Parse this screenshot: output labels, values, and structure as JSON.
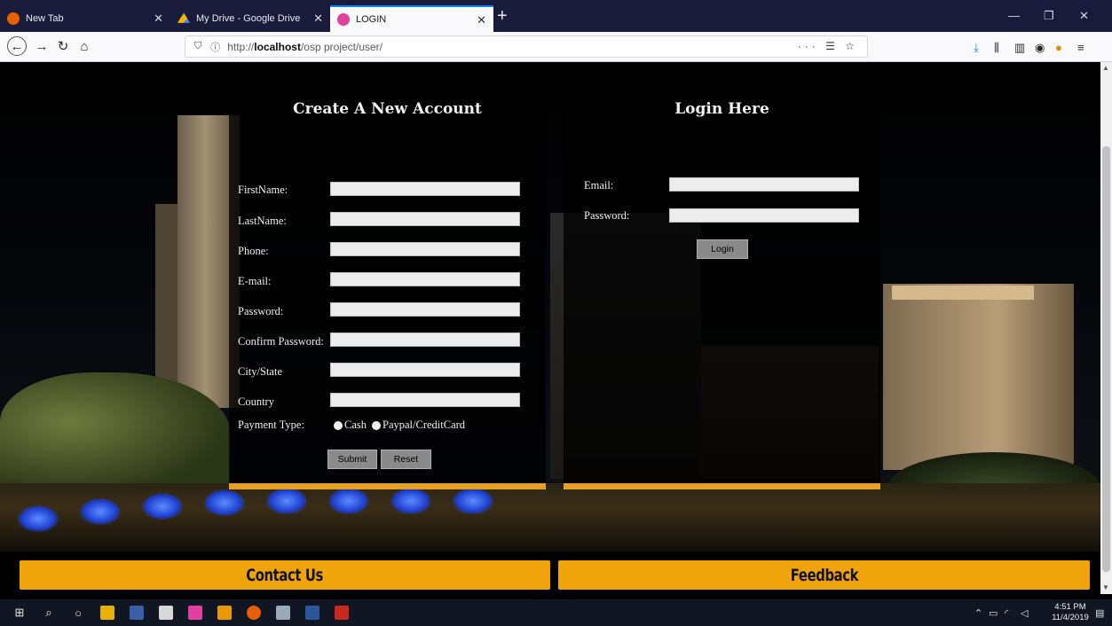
{
  "browser": {
    "tabs": [
      {
        "label": "New Tab",
        "favicon_color": "#e66000"
      },
      {
        "label": "My Drive - Google Drive",
        "favicon_color": "#f4b400"
      },
      {
        "label": "LOGIN",
        "favicon_color": "#e040a0"
      }
    ],
    "active_tab": 2,
    "url_prefix": "http://",
    "url_host": "localhost",
    "url_path": "/osp project/user/",
    "url_actions": "··· ☰ ☆"
  },
  "page": {
    "create": {
      "title": "Create A New Account",
      "fields": [
        {
          "label": "FirstName:"
        },
        {
          "label": "LastName:"
        },
        {
          "label": "Phone:"
        },
        {
          "label": "E-mail:"
        },
        {
          "label": "Password:"
        },
        {
          "label": "Confirm Password:"
        },
        {
          "label": "City/State"
        },
        {
          "label": "Country"
        }
      ],
      "payment_label": "Payment Type:",
      "payment_options": [
        "Cash",
        "Paypal/CreditCard"
      ],
      "submit_label": "Submit",
      "reset_label": "Reset"
    },
    "login": {
      "title": "Login Here",
      "email_label": "Email:",
      "password_label": "Password:",
      "login_label": "Login"
    },
    "footer": {
      "contact_label": "Contact Us",
      "feedback_label": "Feedback"
    },
    "accent_color": "#f0a40c"
  },
  "taskbar": {
    "time": "4:51 PM",
    "date": "11/4/2019"
  }
}
